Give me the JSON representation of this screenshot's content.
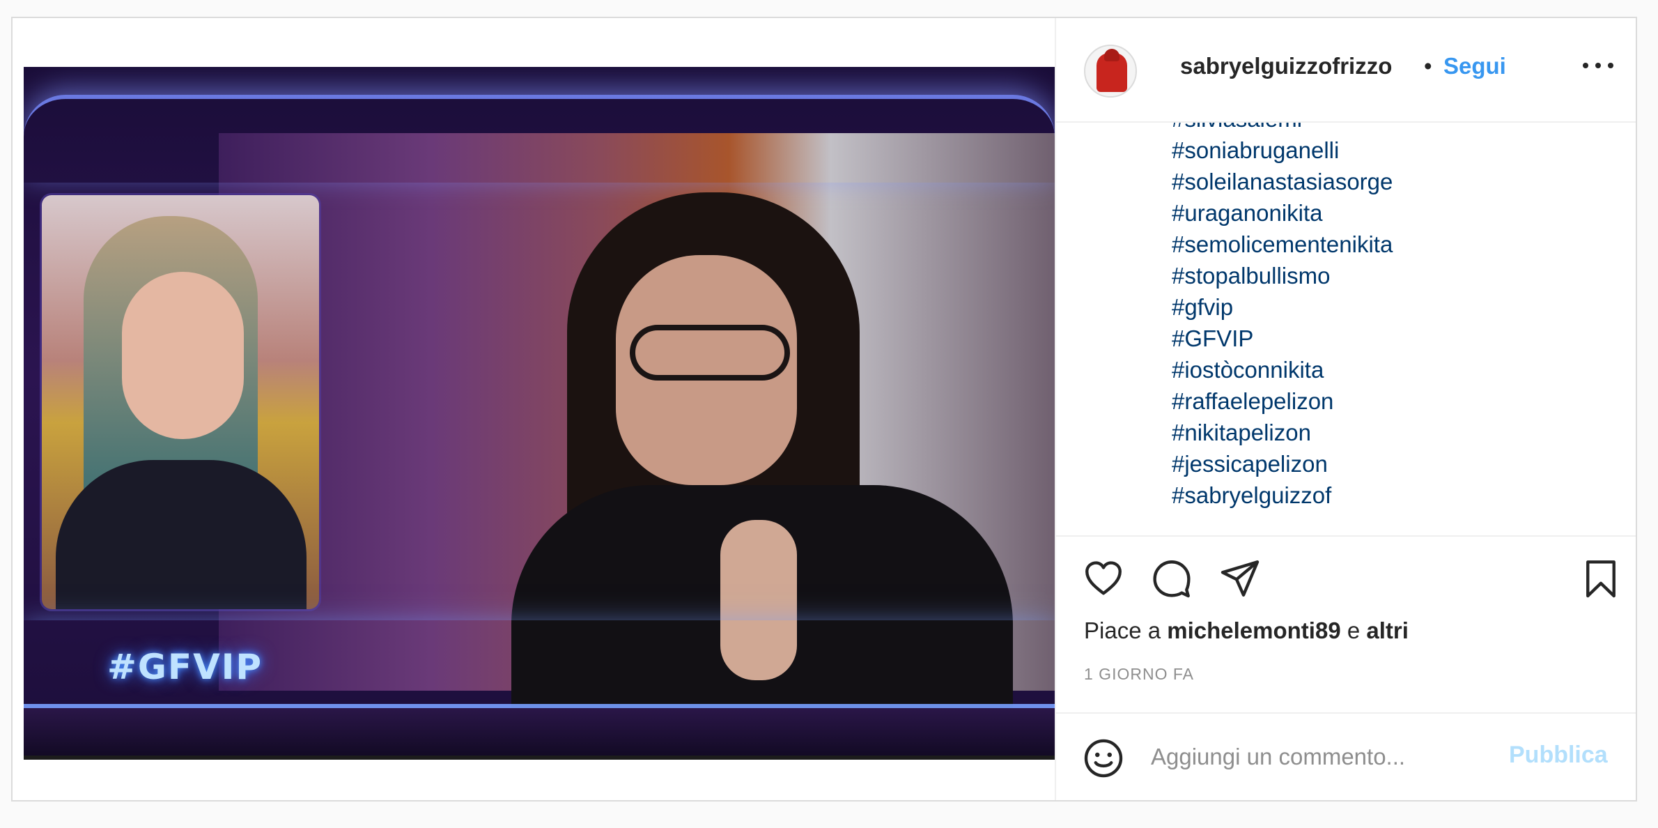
{
  "post": {
    "username": "sabryelguizzofrizzo",
    "separator": "•",
    "follow_label": "Segui",
    "more_icon": "more-horizontal-icon",
    "media_overlay_text": "#GFVIP"
  },
  "caption": {
    "hashtags": [
      "#silviasalemi",
      "#soniabruganelli",
      "#soleilanastasiasorge",
      "#uraganonikita",
      "#semolicementenikita",
      "#stopalbullismo",
      "#gfvip",
      "#GFVIP",
      "#iostòconnikita",
      "#raffaelepelizon",
      "#nikitapelizon",
      "#jessicapelizon",
      "#sabryelguizzof"
    ]
  },
  "actions": {
    "like_icon": "heart-icon",
    "comment_icon": "comment-icon",
    "share_icon": "paper-plane-icon",
    "save_icon": "bookmark-icon"
  },
  "likes": {
    "prefix": "Piace a",
    "user": "michelemonti89",
    "conjunction": "e",
    "others": "altri"
  },
  "timestamp": "1 GIORNO FA",
  "comment": {
    "placeholder": "Aggiungi un commento...",
    "publish_label": "Pubblica",
    "emoji_icon": "smiley-icon"
  },
  "colors": {
    "link_blue": "#3897f0",
    "hashtag": "#00376b",
    "publish_disabled": "#b2dffc",
    "muted": "#8e8e8e"
  }
}
